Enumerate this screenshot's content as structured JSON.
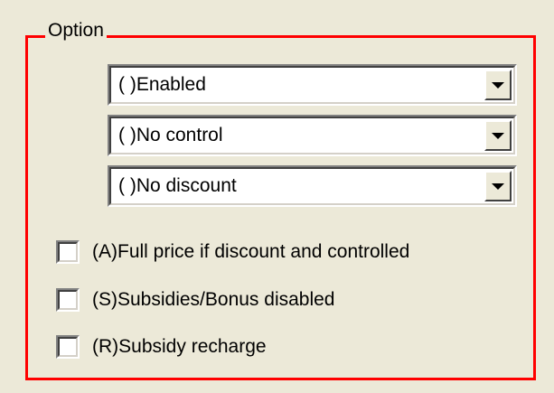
{
  "group": {
    "title": "Option",
    "border_color": "#FF0000"
  },
  "combos": [
    {
      "value": "( )Enabled",
      "button_icon": "chevron-down-icon"
    },
    {
      "value": "( )No control",
      "button_icon": "chevron-down-icon"
    },
    {
      "value": "( )No discount",
      "button_icon": "chevron-down-icon"
    }
  ],
  "checkboxes": [
    {
      "label": "(A)Full price if discount and controlled",
      "checked": false
    },
    {
      "label": "(S)Subsidies/Bonus disabled",
      "checked": false
    },
    {
      "label": "(R)Subsidy recharge",
      "checked": false
    }
  ]
}
